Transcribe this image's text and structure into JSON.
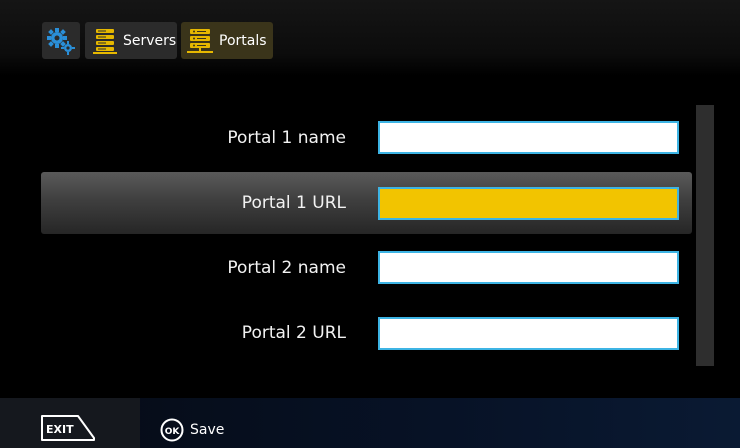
{
  "tabs": {
    "settings_icon": "gear-icon",
    "servers": {
      "label": "Servers",
      "icon": "server-icon"
    },
    "portals": {
      "label": "Portals",
      "icon": "portal-icon"
    }
  },
  "form": {
    "rows": [
      {
        "label": "Portal 1 name",
        "value": ""
      },
      {
        "label": "Portal 1 URL",
        "value": ""
      },
      {
        "label": "Portal 2 name",
        "value": ""
      },
      {
        "label": "Portal 2 URL",
        "value": ""
      }
    ],
    "selected_index": 1
  },
  "footer": {
    "exit_label": "EXIT",
    "ok_badge": "OK",
    "save_label": "Save"
  },
  "colors": {
    "accent_yellow": "#f2c400",
    "field_border": "#3db4e4",
    "icon_blue": "#2a8fd8"
  }
}
